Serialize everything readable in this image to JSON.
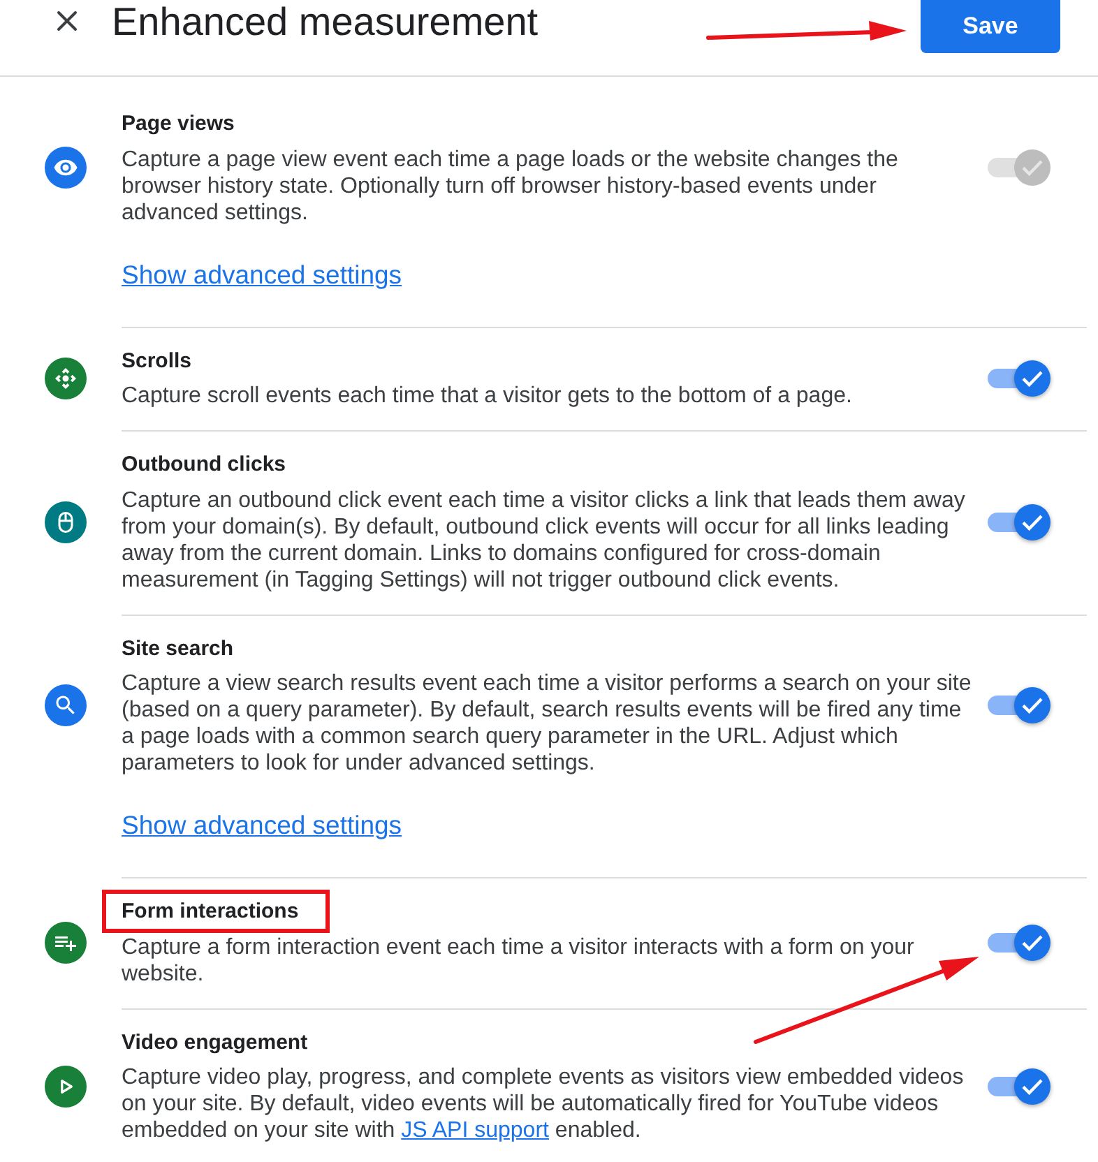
{
  "header": {
    "title": "Enhanced measurement",
    "save_button": {
      "label": "Save",
      "arrow": true
    }
  },
  "items": [
    {
      "kind": "page-views",
      "color": "#1a73e8",
      "title": "Page views",
      "highlighted": false,
      "description": "Capture a page view event each time a page loads or the website changes the browser history state. Optionally turn off browser history-based events under advanced settings.",
      "link": "Show advanced settings",
      "on": true,
      "disabled": true,
      "arrow": false
    },
    {
      "kind": "scrolls",
      "color": "#188038",
      "title": "Scrolls",
      "highlighted": false,
      "description": "Capture scroll events each time that a visitor gets to the bottom of a page.",
      "on": true,
      "disabled": false,
      "arrow": false
    },
    {
      "kind": "outbound-clicks",
      "color": "#007b83",
      "title": "Outbound clicks",
      "highlighted": false,
      "description": "Capture an outbound click event each time a visitor clicks a link that leads them away from your domain(s). By default, outbound click events will occur for all links leading away from the current domain. Links to domains configured for cross-domain measurement (in Tagging Settings) will not trigger outbound click events.",
      "on": true,
      "disabled": false,
      "arrow": false
    },
    {
      "kind": "site-search",
      "color": "#1a73e8",
      "title": "Site search",
      "highlighted": false,
      "description": "Capture a view search results event each time a visitor performs a search on your site (based on a query parameter). By default, search results events will be fired any time a page loads with a common search query parameter in the URL. Adjust which parameters to look for under advanced settings.",
      "link": "Show advanced settings",
      "on": true,
      "disabled": false,
      "arrow": false
    },
    {
      "kind": "form-interactions",
      "color": "#188038",
      "title": "Form interactions",
      "highlighted": true,
      "description": "Capture a form interaction event each time a visitor interacts with a form on your website.",
      "on": true,
      "disabled": false,
      "arrow": true
    },
    {
      "kind": "video-engagement",
      "color": "#188038",
      "title": "Video engagement",
      "highlighted": false,
      "description": [
        {
          "kind": "text",
          "text": "Capture video play, progress, and complete events as visitors view embedded videos on your site. By default, video events will be automatically fired for YouTube videos embedded on your site with "
        },
        {
          "kind": "link",
          "text": "JS API support"
        },
        {
          "kind": "text",
          "text": " enabled."
        }
      ],
      "on": true,
      "disabled": false,
      "arrow": false
    }
  ]
}
